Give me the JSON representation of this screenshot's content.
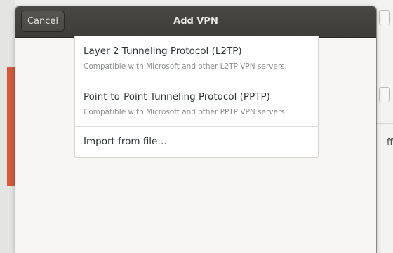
{
  "dialog": {
    "title": "Add VPN",
    "cancel_label": "Cancel"
  },
  "options": [
    {
      "title": "Layer 2 Tunneling Protocol (L2TP)",
      "subtitle": "Compatible with Microsoft and other L2TP VPN servers."
    },
    {
      "title": "Point-to-Point Tunneling Protocol (PPTP)",
      "subtitle": "Compatible with Microsoft and other PPTP VPN servers."
    },
    {
      "title": "Import from file…"
    }
  ],
  "background": {
    "partial_label": "ff"
  },
  "colors": {
    "titlebar": "#3e3c38",
    "accent": "#d4583a",
    "dialog_bg": "#f6f5f4"
  }
}
